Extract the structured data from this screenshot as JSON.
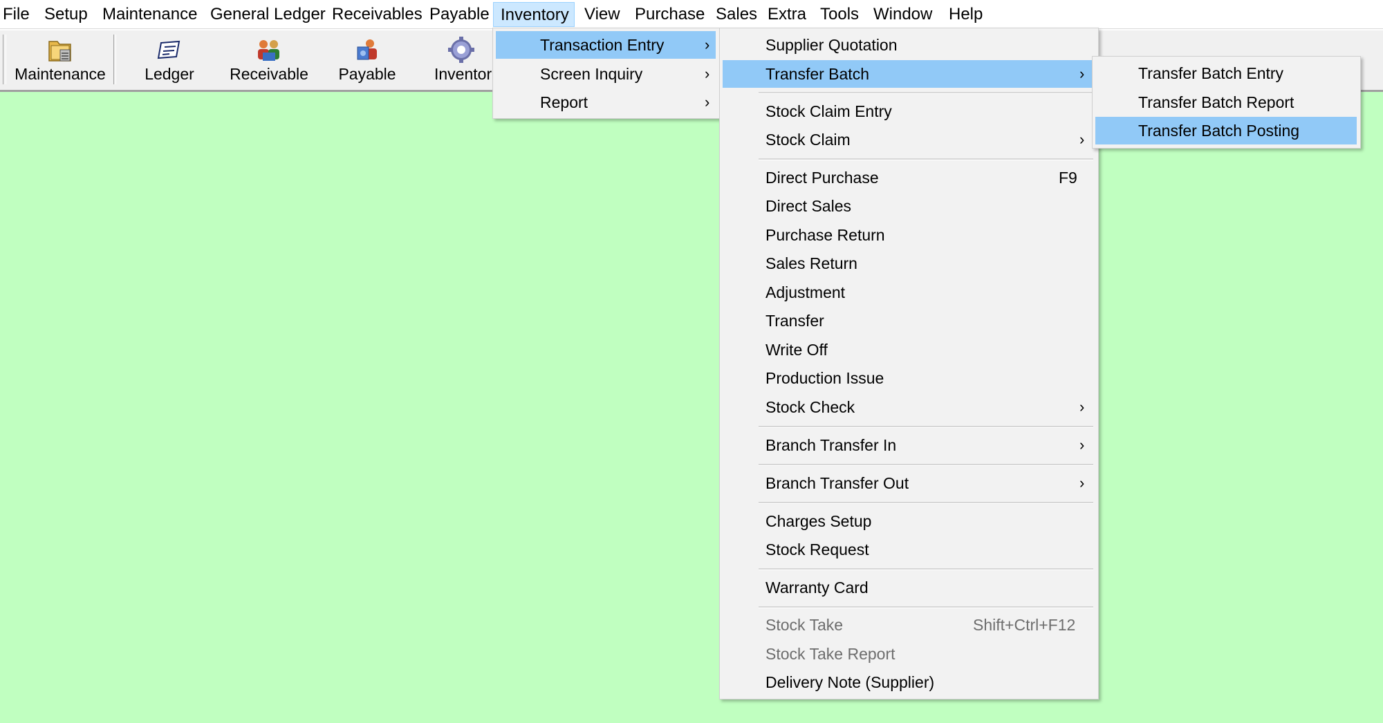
{
  "menubar": {
    "items": [
      {
        "label": "File"
      },
      {
        "label": "Setup"
      },
      {
        "label": "Maintenance"
      },
      {
        "label": "General Ledger"
      },
      {
        "label": "Receivables"
      },
      {
        "label": "Payable"
      },
      {
        "label": "Inventory"
      },
      {
        "label": "View"
      },
      {
        "label": "Purchase"
      },
      {
        "label": "Sales"
      },
      {
        "label": "Extra"
      },
      {
        "label": "Tools"
      },
      {
        "label": "Window"
      },
      {
        "label": "Help"
      }
    ],
    "active": "Inventory"
  },
  "toolbar": {
    "buttons": [
      {
        "label": "Maintenance",
        "icon": "folder-icon"
      },
      {
        "label": "Ledger",
        "icon": "ledger-icon"
      },
      {
        "label": "Receivable",
        "icon": "receivable-icon"
      },
      {
        "label": "Payable",
        "icon": "payable-icon"
      },
      {
        "label": "Inventor",
        "icon": "gear-icon"
      }
    ]
  },
  "inventory_menu": {
    "items": [
      {
        "label": "Transaction Entry"
      },
      {
        "label": "Screen Inquiry"
      },
      {
        "label": "Report"
      }
    ],
    "highlighted": "Transaction Entry"
  },
  "transaction_menu": {
    "items": [
      {
        "label": "Supplier Quotation"
      },
      {
        "label": "Transfer Batch"
      },
      {
        "label": "Stock Claim Entry"
      },
      {
        "label": "Stock Claim"
      },
      {
        "label": "Direct Purchase",
        "shortcut": "F9"
      },
      {
        "label": "Direct Sales"
      },
      {
        "label": "Purchase Return"
      },
      {
        "label": "Sales Return"
      },
      {
        "label": "Adjustment"
      },
      {
        "label": "Transfer"
      },
      {
        "label": "Write Off"
      },
      {
        "label": "Production Issue"
      },
      {
        "label": "Stock Check"
      },
      {
        "label": "Branch Transfer In"
      },
      {
        "label": "Branch Transfer Out"
      },
      {
        "label": "Charges Setup"
      },
      {
        "label": "Stock Request"
      },
      {
        "label": "Warranty Card"
      },
      {
        "label": "Stock Take",
        "shortcut": "Shift+Ctrl+F12",
        "disabled": true
      },
      {
        "label": "Stock Take Report",
        "disabled": true
      },
      {
        "label": "Delivery Note (Supplier)"
      }
    ],
    "highlighted": "Transfer Batch"
  },
  "transfer_batch_menu": {
    "items": [
      {
        "label": "Transfer Batch Entry"
      },
      {
        "label": "Transfer Batch Report"
      },
      {
        "label": "Transfer Batch Posting"
      }
    ],
    "highlighted": "Transfer Batch Posting"
  },
  "colors": {
    "background": "#c0ffc0",
    "menu_highlight": "#91c9f7",
    "menubar_active": "#cce8ff"
  }
}
